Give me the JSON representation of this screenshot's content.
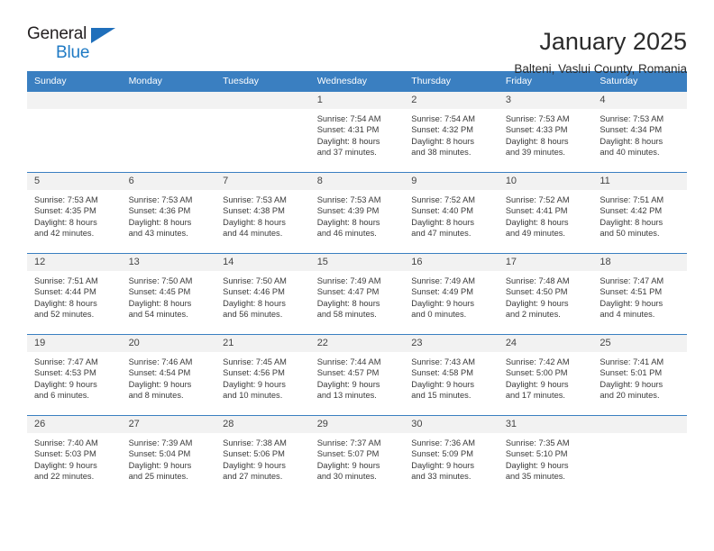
{
  "brand": {
    "name_part1": "General",
    "name_part2": "Blue",
    "triangle_color": "#1f6fbb",
    "blue_text_color": "#1f7ac4"
  },
  "header": {
    "title": "January 2025",
    "subtitle": "Balteni, Vaslui County, Romania"
  },
  "theme": {
    "header_blue": "#3a7fc1",
    "cell_shade": "#f2f2f2",
    "text": "#3a3a3a"
  },
  "weekdays": [
    "Sunday",
    "Monday",
    "Tuesday",
    "Wednesday",
    "Thursday",
    "Friday",
    "Saturday"
  ],
  "weeks": [
    [
      {
        "day": "",
        "empty": true
      },
      {
        "day": "",
        "empty": true
      },
      {
        "day": "",
        "empty": true
      },
      {
        "day": "1",
        "sunrise": "Sunrise: 7:54 AM",
        "sunset": "Sunset: 4:31 PM",
        "daylight1": "Daylight: 8 hours",
        "daylight2": "and 37 minutes."
      },
      {
        "day": "2",
        "sunrise": "Sunrise: 7:54 AM",
        "sunset": "Sunset: 4:32 PM",
        "daylight1": "Daylight: 8 hours",
        "daylight2": "and 38 minutes."
      },
      {
        "day": "3",
        "sunrise": "Sunrise: 7:53 AM",
        "sunset": "Sunset: 4:33 PM",
        "daylight1": "Daylight: 8 hours",
        "daylight2": "and 39 minutes."
      },
      {
        "day": "4",
        "sunrise": "Sunrise: 7:53 AM",
        "sunset": "Sunset: 4:34 PM",
        "daylight1": "Daylight: 8 hours",
        "daylight2": "and 40 minutes."
      }
    ],
    [
      {
        "day": "5",
        "sunrise": "Sunrise: 7:53 AM",
        "sunset": "Sunset: 4:35 PM",
        "daylight1": "Daylight: 8 hours",
        "daylight2": "and 42 minutes."
      },
      {
        "day": "6",
        "sunrise": "Sunrise: 7:53 AM",
        "sunset": "Sunset: 4:36 PM",
        "daylight1": "Daylight: 8 hours",
        "daylight2": "and 43 minutes."
      },
      {
        "day": "7",
        "sunrise": "Sunrise: 7:53 AM",
        "sunset": "Sunset: 4:38 PM",
        "daylight1": "Daylight: 8 hours",
        "daylight2": "and 44 minutes."
      },
      {
        "day": "8",
        "sunrise": "Sunrise: 7:53 AM",
        "sunset": "Sunset: 4:39 PM",
        "daylight1": "Daylight: 8 hours",
        "daylight2": "and 46 minutes."
      },
      {
        "day": "9",
        "sunrise": "Sunrise: 7:52 AM",
        "sunset": "Sunset: 4:40 PM",
        "daylight1": "Daylight: 8 hours",
        "daylight2": "and 47 minutes."
      },
      {
        "day": "10",
        "sunrise": "Sunrise: 7:52 AM",
        "sunset": "Sunset: 4:41 PM",
        "daylight1": "Daylight: 8 hours",
        "daylight2": "and 49 minutes."
      },
      {
        "day": "11",
        "sunrise": "Sunrise: 7:51 AM",
        "sunset": "Sunset: 4:42 PM",
        "daylight1": "Daylight: 8 hours",
        "daylight2": "and 50 minutes."
      }
    ],
    [
      {
        "day": "12",
        "sunrise": "Sunrise: 7:51 AM",
        "sunset": "Sunset: 4:44 PM",
        "daylight1": "Daylight: 8 hours",
        "daylight2": "and 52 minutes."
      },
      {
        "day": "13",
        "sunrise": "Sunrise: 7:50 AM",
        "sunset": "Sunset: 4:45 PM",
        "daylight1": "Daylight: 8 hours",
        "daylight2": "and 54 minutes."
      },
      {
        "day": "14",
        "sunrise": "Sunrise: 7:50 AM",
        "sunset": "Sunset: 4:46 PM",
        "daylight1": "Daylight: 8 hours",
        "daylight2": "and 56 minutes."
      },
      {
        "day": "15",
        "sunrise": "Sunrise: 7:49 AM",
        "sunset": "Sunset: 4:47 PM",
        "daylight1": "Daylight: 8 hours",
        "daylight2": "and 58 minutes."
      },
      {
        "day": "16",
        "sunrise": "Sunrise: 7:49 AM",
        "sunset": "Sunset: 4:49 PM",
        "daylight1": "Daylight: 9 hours",
        "daylight2": "and 0 minutes."
      },
      {
        "day": "17",
        "sunrise": "Sunrise: 7:48 AM",
        "sunset": "Sunset: 4:50 PM",
        "daylight1": "Daylight: 9 hours",
        "daylight2": "and 2 minutes."
      },
      {
        "day": "18",
        "sunrise": "Sunrise: 7:47 AM",
        "sunset": "Sunset: 4:51 PM",
        "daylight1": "Daylight: 9 hours",
        "daylight2": "and 4 minutes."
      }
    ],
    [
      {
        "day": "19",
        "sunrise": "Sunrise: 7:47 AM",
        "sunset": "Sunset: 4:53 PM",
        "daylight1": "Daylight: 9 hours",
        "daylight2": "and 6 minutes."
      },
      {
        "day": "20",
        "sunrise": "Sunrise: 7:46 AM",
        "sunset": "Sunset: 4:54 PM",
        "daylight1": "Daylight: 9 hours",
        "daylight2": "and 8 minutes."
      },
      {
        "day": "21",
        "sunrise": "Sunrise: 7:45 AM",
        "sunset": "Sunset: 4:56 PM",
        "daylight1": "Daylight: 9 hours",
        "daylight2": "and 10 minutes."
      },
      {
        "day": "22",
        "sunrise": "Sunrise: 7:44 AM",
        "sunset": "Sunset: 4:57 PM",
        "daylight1": "Daylight: 9 hours",
        "daylight2": "and 13 minutes."
      },
      {
        "day": "23",
        "sunrise": "Sunrise: 7:43 AM",
        "sunset": "Sunset: 4:58 PM",
        "daylight1": "Daylight: 9 hours",
        "daylight2": "and 15 minutes."
      },
      {
        "day": "24",
        "sunrise": "Sunrise: 7:42 AM",
        "sunset": "Sunset: 5:00 PM",
        "daylight1": "Daylight: 9 hours",
        "daylight2": "and 17 minutes."
      },
      {
        "day": "25",
        "sunrise": "Sunrise: 7:41 AM",
        "sunset": "Sunset: 5:01 PM",
        "daylight1": "Daylight: 9 hours",
        "daylight2": "and 20 minutes."
      }
    ],
    [
      {
        "day": "26",
        "sunrise": "Sunrise: 7:40 AM",
        "sunset": "Sunset: 5:03 PM",
        "daylight1": "Daylight: 9 hours",
        "daylight2": "and 22 minutes."
      },
      {
        "day": "27",
        "sunrise": "Sunrise: 7:39 AM",
        "sunset": "Sunset: 5:04 PM",
        "daylight1": "Daylight: 9 hours",
        "daylight2": "and 25 minutes."
      },
      {
        "day": "28",
        "sunrise": "Sunrise: 7:38 AM",
        "sunset": "Sunset: 5:06 PM",
        "daylight1": "Daylight: 9 hours",
        "daylight2": "and 27 minutes."
      },
      {
        "day": "29",
        "sunrise": "Sunrise: 7:37 AM",
        "sunset": "Sunset: 5:07 PM",
        "daylight1": "Daylight: 9 hours",
        "daylight2": "and 30 minutes."
      },
      {
        "day": "30",
        "sunrise": "Sunrise: 7:36 AM",
        "sunset": "Sunset: 5:09 PM",
        "daylight1": "Daylight: 9 hours",
        "daylight2": "and 33 minutes."
      },
      {
        "day": "31",
        "sunrise": "Sunrise: 7:35 AM",
        "sunset": "Sunset: 5:10 PM",
        "daylight1": "Daylight: 9 hours",
        "daylight2": "and 35 minutes."
      },
      {
        "day": "",
        "empty": true
      }
    ]
  ]
}
